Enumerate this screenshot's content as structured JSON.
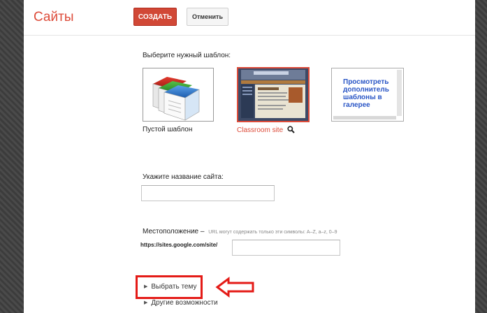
{
  "header": {
    "app_title": "Сайты",
    "create_label": "СОЗДАТЬ",
    "cancel_label": "Отменить"
  },
  "templates": {
    "prompt": "Выберите нужный шаблон:",
    "items": [
      {
        "caption": "Пустой шаблон",
        "selected": false
      },
      {
        "caption": "Classroom site",
        "selected": true
      },
      {
        "caption": "Просмотреть дополнитель шаблоны в галерее",
        "selected": false
      }
    ]
  },
  "site_name": {
    "label": "Укажите название сайта:",
    "value": ""
  },
  "location": {
    "label": "Местоположение –",
    "hint": "URL могут содержать только эти символы: A–Z, a–z, 0–9",
    "prefix": "https://sites.google.com/site/",
    "value": ""
  },
  "sections": {
    "choose_theme": "Выбрать тему",
    "more_options": "Другие возможности"
  },
  "colors": {
    "accent": "#dd4b39",
    "highlight": "#e41b17",
    "link": "#2a56c6"
  },
  "icons": [
    "documents-icon",
    "search-icon",
    "triangle-right-icon",
    "arrow-left-icon"
  ]
}
